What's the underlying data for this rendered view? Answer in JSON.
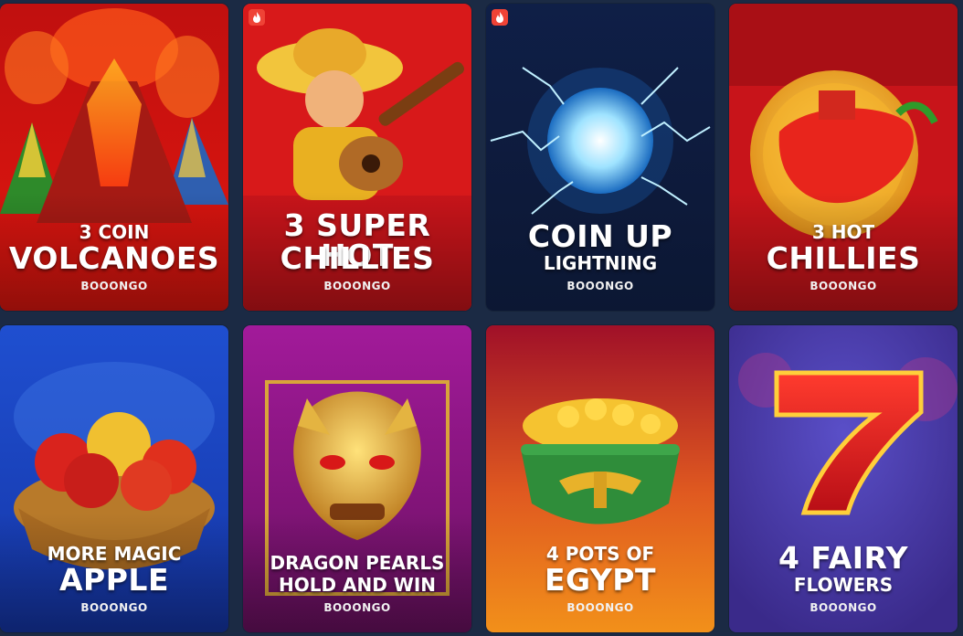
{
  "games": [
    {
      "line1": "3 COIN",
      "line2": "VOLCANOES",
      "provider": "BOOONGO",
      "hot": false
    },
    {
      "line1": "3 SUPER HOT",
      "line2": "CHILLIES",
      "provider": "BOOONGO",
      "hot": true
    },
    {
      "line1": "COIN UP",
      "line2": "LIGHTNING",
      "provider": "BOOONGO",
      "hot": true
    },
    {
      "line1": "3 HOT",
      "line2": "CHILLIES",
      "provider": "BOOONGO",
      "hot": false
    },
    {
      "line1": "MORE MAGIC",
      "line2": "APPLE",
      "provider": "BOOONGO",
      "hot": false
    },
    {
      "line1": "DRAGON PEARLS",
      "line2": "HOLD AND WIN",
      "provider": "BOOONGO",
      "hot": false
    },
    {
      "line1": "4 POTS OF",
      "line2": "EGYPT",
      "provider": "BOOONGO",
      "hot": false
    },
    {
      "line1": "4 FAIRY",
      "line2": "FLOWERS",
      "provider": "BOOONGO",
      "hot": false
    }
  ],
  "colors": {
    "background": "#1b2a44",
    "hot_badge": "#ef4336"
  },
  "icons": {
    "hot_badge": "flame-icon"
  }
}
